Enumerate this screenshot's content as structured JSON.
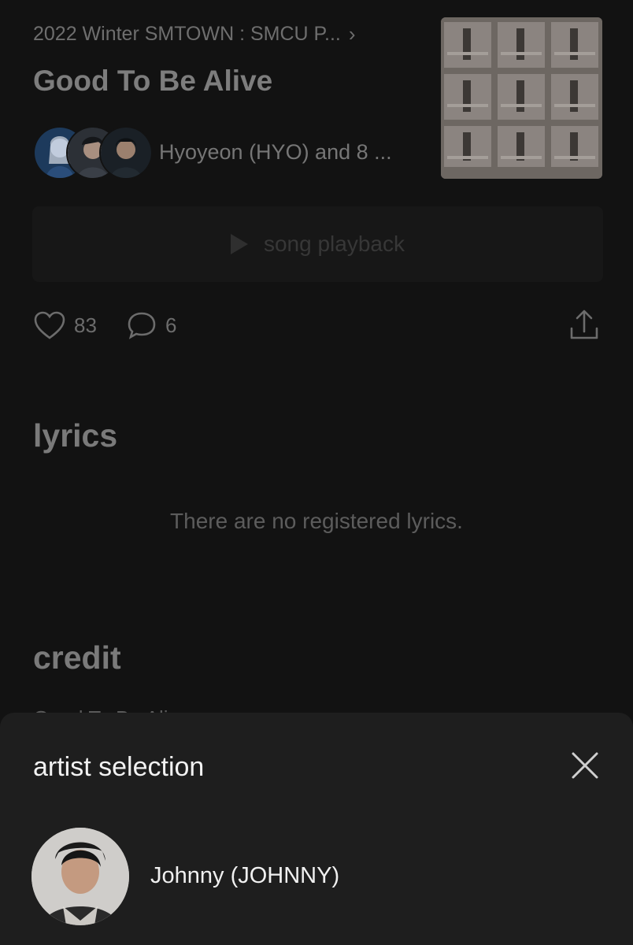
{
  "album": {
    "title": "2022 Winter SMTOWN : SMCU P...",
    "chevron_icon": "chevron-right-icon"
  },
  "song": {
    "title": "Good To Be Alive",
    "artists_text": "Hyoyeon (HYO) and 8 ..."
  },
  "playback": {
    "label": "song playback",
    "icon": "play-icon"
  },
  "actions": {
    "likes": "83",
    "comments": "6",
    "like_icon": "heart-icon",
    "comment_icon": "comment-icon",
    "share_icon": "share-icon"
  },
  "lyrics": {
    "heading": "lyrics",
    "empty_text": "There are no registered lyrics."
  },
  "credit": {
    "heading": "credit",
    "first_line": "Good To Be Ali..."
  },
  "sheet": {
    "title": "artist selection",
    "close_icon": "close-icon",
    "artists": [
      {
        "name": "Johnny (JOHNNY)"
      }
    ]
  },
  "colors": {
    "background": "#121212",
    "sheet_background": "#1e1e1e",
    "text_primary": "#f2f2f2",
    "text_dim": "#7a7a7a"
  }
}
